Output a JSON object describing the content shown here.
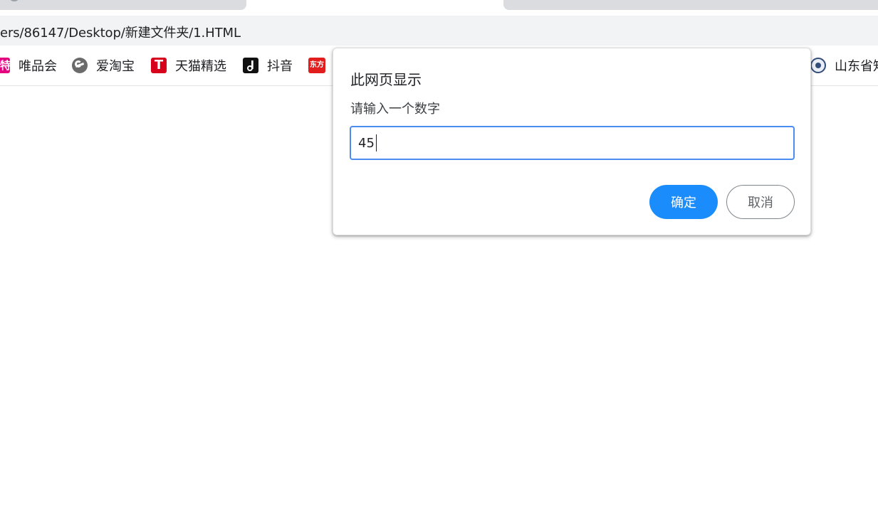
{
  "address_bar": {
    "url": "ers/86147/Desktop/新建文件夹/1.HTML"
  },
  "bookmarks": [
    {
      "label": "唯品会",
      "icon": "vipshop-icon",
      "icon_glyph": "特"
    },
    {
      "label": "爱淘宝",
      "icon": "aitaobao-icon",
      "icon_glyph": ""
    },
    {
      "label": "天猫精选",
      "icon": "tmall-icon",
      "icon_glyph": "T"
    },
    {
      "label": "抖音",
      "icon": "douyin-icon",
      "icon_glyph": ""
    },
    {
      "label": "",
      "icon": "dongfang-icon",
      "icon_glyph": "东方"
    },
    {
      "label": "山东省知",
      "icon": "shandong-icon",
      "icon_glyph": ""
    }
  ],
  "dialog": {
    "title": "此网页显示",
    "message": "请输入一个数字",
    "input_value": "45",
    "ok_label": "确定",
    "cancel_label": "取消"
  },
  "colors": {
    "accent": "#1a8cfb",
    "input_focus": "#4a8cf0",
    "tab_inactive": "#dadce0",
    "addressbar_bg": "#f1f3f4"
  }
}
